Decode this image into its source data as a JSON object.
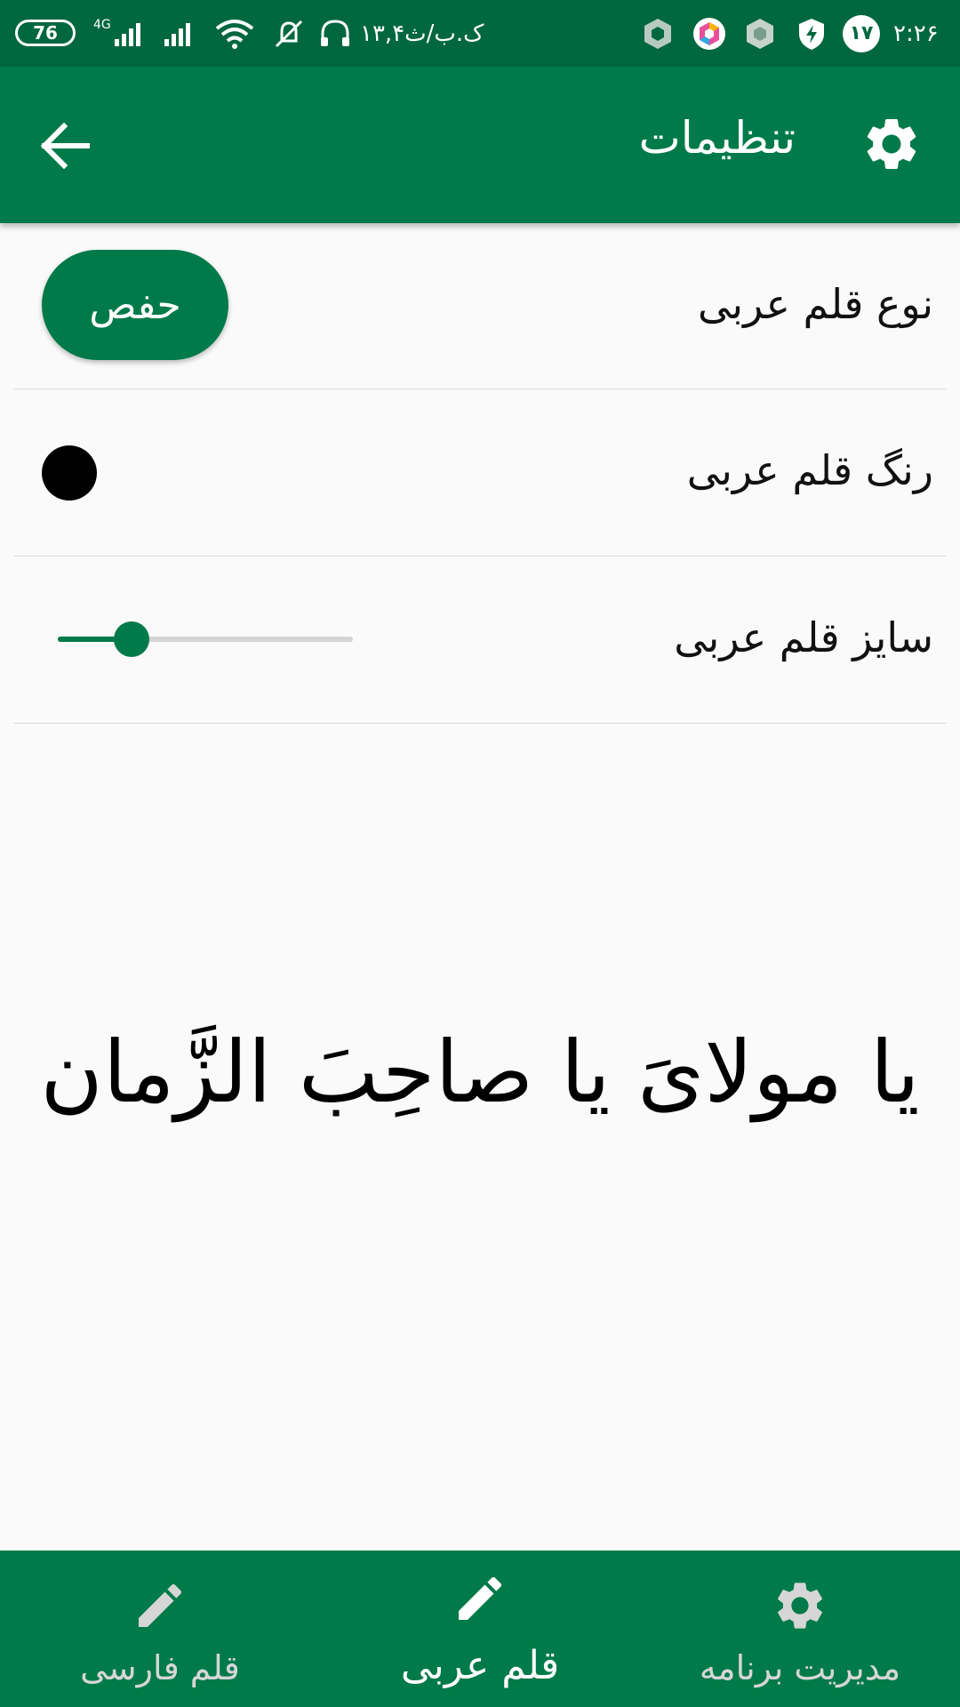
{
  "status_bar": {
    "battery": "76",
    "network": "4G",
    "date": "ک.ب/ث۱۳,۴",
    "notification_count": "۱۷",
    "time": "۲:۲۶"
  },
  "app_bar": {
    "title": "تنظیمات"
  },
  "settings": {
    "font_type": {
      "label": "نوع قلم عربی",
      "value": "حفص"
    },
    "font_color": {
      "label": "رنگ قلم عربی",
      "color": "#000000"
    },
    "font_size": {
      "label": "سایز قلم عربی",
      "slider_fraction": 0.25
    }
  },
  "preview": {
    "text": "یا مولاىَ یا صاحِبَ الزَّمان"
  },
  "bottom_nav": {
    "items": [
      {
        "label": "قلم فارسی",
        "icon": "pencil-icon",
        "active": false
      },
      {
        "label": "قلم عربی",
        "icon": "pencil-icon",
        "active": true
      },
      {
        "label": "مدیریت برنامه",
        "icon": "gear-icon",
        "active": false
      }
    ]
  },
  "colors": {
    "primary": "#007a49",
    "status_bar": "#00673f",
    "background": "#fafafa",
    "inactive_nav": "#d6d6d6"
  }
}
